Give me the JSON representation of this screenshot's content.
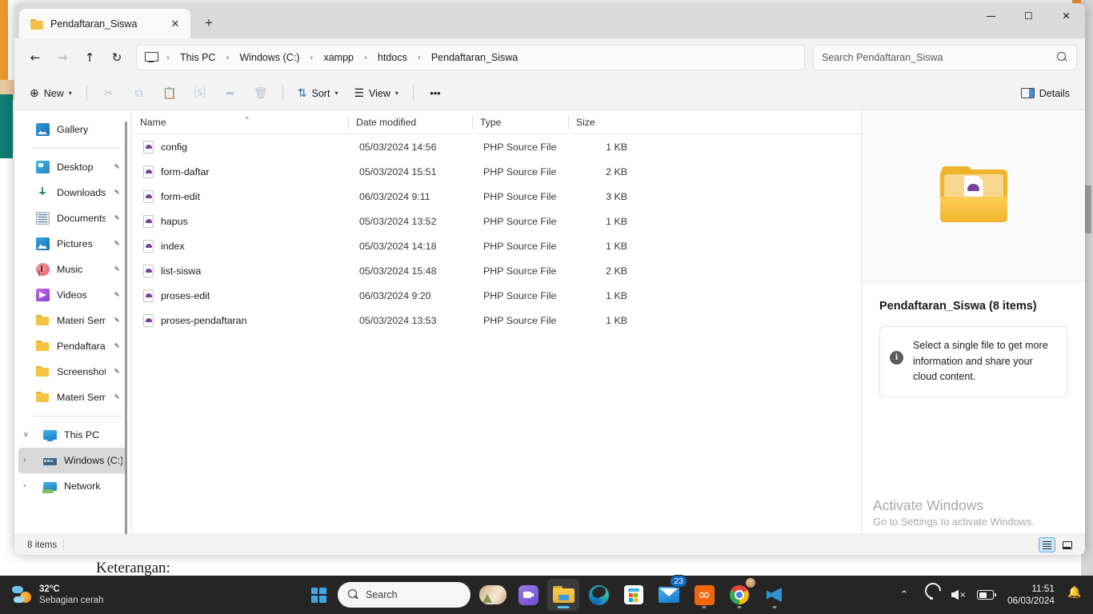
{
  "background": {
    "page_text": "Keterangan:"
  },
  "window": {
    "tab": {
      "title": "Pendaftaran_Siswa",
      "close_label": "✕",
      "folder_icon": "folder-icon"
    },
    "new_tab_label": "+",
    "controls": {
      "minimize": "—",
      "maximize": "☐",
      "close": "✕"
    }
  },
  "navigation": {
    "back": "←",
    "forward": "→",
    "up": "↑",
    "refresh": "↻",
    "breadcrumb": [
      "This PC",
      "Windows (C:)",
      "xampp",
      "htdocs",
      "Pendaftaran_Siswa"
    ],
    "separator": "›"
  },
  "search": {
    "placeholder": "Search Pendaftaran_Siswa",
    "value": "",
    "icon": "search-icon"
  },
  "toolbar": {
    "new_label": "New",
    "new_icon": "plus-circle-icon",
    "cut_icon": "✂",
    "copy_icon": "⧉",
    "paste_icon": "❐",
    "rename_icon": "Ⓐ",
    "share_icon": "➦",
    "delete_icon": "Ὕ1",
    "sort_label": "Sort",
    "sort_icon": "⇅",
    "view_label": "View",
    "view_icon": "☰",
    "more_label": "•••",
    "details_label": "Details",
    "chevron": "∨"
  },
  "sidebar": {
    "items": [
      {
        "label": "Gallery",
        "icon": "gallery-icon",
        "pinned": false,
        "kind": "gallery",
        "expander": "",
        "selected": false
      },
      {
        "label": "Desktop",
        "icon": "desktop-icon",
        "pinned": true,
        "kind": "desktop",
        "expander": "",
        "selected": false
      },
      {
        "label": "Downloads",
        "icon": "download-icon",
        "pinned": true,
        "kind": "downloads",
        "expander": "",
        "selected": false
      },
      {
        "label": "Documents",
        "icon": "documents-icon",
        "pinned": true,
        "kind": "documents",
        "expander": "",
        "selected": false
      },
      {
        "label": "Pictures",
        "icon": "pictures-icon",
        "pinned": true,
        "kind": "pictures",
        "expander": "",
        "selected": false
      },
      {
        "label": "Music",
        "icon": "music-icon",
        "pinned": true,
        "kind": "music",
        "expander": "",
        "selected": false
      },
      {
        "label": "Videos",
        "icon": "videos-icon",
        "pinned": true,
        "kind": "videos",
        "expander": "",
        "selected": false
      },
      {
        "label": "Materi Semes",
        "icon": "folder-icon",
        "pinned": true,
        "kind": "folder",
        "expander": "",
        "selected": false
      },
      {
        "label": "Pendaftaran_",
        "icon": "folder-icon",
        "pinned": true,
        "kind": "folder",
        "expander": "",
        "selected": false
      },
      {
        "label": "Screenshots",
        "icon": "folder-icon",
        "pinned": true,
        "kind": "folder",
        "expander": "",
        "selected": false
      },
      {
        "label": "Materi Semes",
        "icon": "folder-icon",
        "pinned": true,
        "kind": "folder",
        "expander": "",
        "selected": false
      },
      {
        "label": "This PC",
        "icon": "this-pc-icon",
        "pinned": false,
        "kind": "thispc",
        "expander": "∨",
        "selected": false
      },
      {
        "label": "Windows (C:)",
        "icon": "drive-icon",
        "pinned": false,
        "kind": "drive",
        "expander": "›",
        "selected": true
      },
      {
        "label": "Network",
        "icon": "network-icon",
        "pinned": false,
        "kind": "network",
        "expander": "›",
        "selected": false
      }
    ],
    "separator_after": [
      0,
      10
    ],
    "pin_glyph": "✒"
  },
  "filelist": {
    "columns": [
      "Name",
      "Date modified",
      "Type",
      "Size"
    ],
    "sort_indicator": "⌃",
    "rows": [
      {
        "name": "config",
        "date": "05/03/2024 14:56",
        "type": "PHP Source File",
        "size": "1 KB",
        "icon": "php-file-icon"
      },
      {
        "name": "form-daftar",
        "date": "05/03/2024 15:51",
        "type": "PHP Source File",
        "size": "2 KB",
        "icon": "php-file-icon"
      },
      {
        "name": "form-edit",
        "date": "06/03/2024 9:11",
        "type": "PHP Source File",
        "size": "3 KB",
        "icon": "php-file-icon"
      },
      {
        "name": "hapus",
        "date": "05/03/2024 13:52",
        "type": "PHP Source File",
        "size": "1 KB",
        "icon": "php-file-icon"
      },
      {
        "name": "index",
        "date": "05/03/2024 14:18",
        "type": "PHP Source File",
        "size": "1 KB",
        "icon": "php-file-icon"
      },
      {
        "name": "list-siswa",
        "date": "05/03/2024 15:48",
        "type": "PHP Source File",
        "size": "2 KB",
        "icon": "php-file-icon"
      },
      {
        "name": "proses-edit",
        "date": "06/03/2024 9:20",
        "type": "PHP Source File",
        "size": "1 KB",
        "icon": "php-file-icon"
      },
      {
        "name": "proses-pendaftaran",
        "date": "05/03/2024 13:53",
        "type": "PHP Source File",
        "size": "1 KB",
        "icon": "php-file-icon"
      }
    ]
  },
  "details_pane": {
    "preview_icon": "folder-with-file-icon",
    "title": "Pendaftaran_Siswa (8 items)",
    "info_icon": "info-icon",
    "info_text": "Select a single file to get more information and share your cloud content."
  },
  "watermark": {
    "title": "Activate Windows",
    "subtitle": "Go to Settings to activate Windows."
  },
  "statusbar": {
    "item_count": "8 items",
    "layout_details_icon": "details-view-icon",
    "layout_tiles_icon": "tiles-view-icon"
  },
  "taskbar": {
    "weather": {
      "temperature": "32°C",
      "description": "Sebagian cerah",
      "icon": "partly-cloudy-icon"
    },
    "start_icon": "windows-logo-icon",
    "search": {
      "label": "Search",
      "icon": "search-icon"
    },
    "apps": [
      {
        "name": "copilot",
        "icon": "copilot-icon",
        "running": false,
        "active": false,
        "badge": ""
      },
      {
        "name": "teams",
        "icon": "teams-icon",
        "running": false,
        "active": false,
        "badge": ""
      },
      {
        "name": "file-explorer",
        "icon": "file-explorer-icon",
        "running": true,
        "active": true,
        "badge": ""
      },
      {
        "name": "edge",
        "icon": "edge-icon",
        "running": false,
        "active": false,
        "badge": ""
      },
      {
        "name": "store",
        "icon": "microsoft-store-icon",
        "running": false,
        "active": false,
        "badge": ""
      },
      {
        "name": "mail",
        "icon": "mail-icon",
        "running": false,
        "active": false,
        "badge": "23"
      },
      {
        "name": "xampp",
        "icon": "xampp-icon",
        "running": true,
        "active": false,
        "badge": ""
      },
      {
        "name": "chrome",
        "icon": "chrome-icon",
        "running": true,
        "active": false,
        "badge": ""
      },
      {
        "name": "vscode",
        "icon": "vscode-icon",
        "running": true,
        "active": false,
        "badge": ""
      }
    ],
    "tray": {
      "overflow_icon": "⌃",
      "wifi_icon": "wifi-icon",
      "volume_icon": "volume-muted-icon",
      "battery_icon": "battery-icon",
      "time": "11:51",
      "date": "06/03/2024",
      "notification_icon": "notification-bell-dnd-icon"
    }
  },
  "colors": {
    "accent": "#0f6cbd",
    "taskbar": "#252525",
    "folder_yellow": "#f4c342",
    "php_purple": "#7b3fa0",
    "selection": "#d8d8d8"
  }
}
